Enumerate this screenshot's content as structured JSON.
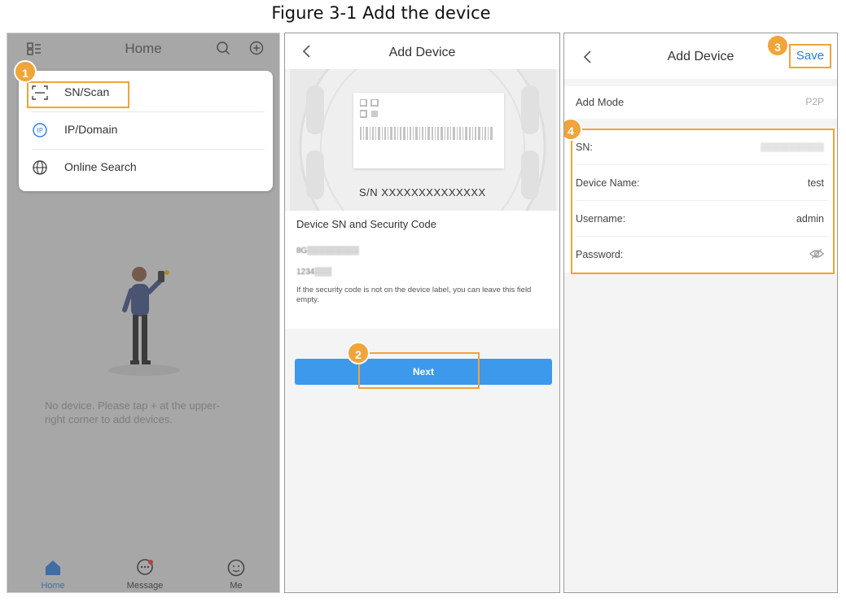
{
  "caption": "Figure 3-1 Add the device",
  "colors": {
    "accent": "#f0a43a",
    "blue": "#3d99ec",
    "link": "#2a7de1"
  },
  "panel1": {
    "title": "Home",
    "menu": [
      {
        "label": "SN/Scan",
        "icon": "scan-icon"
      },
      {
        "label": "IP/Domain",
        "icon": "ip-icon"
      },
      {
        "label": "Online Search",
        "icon": "globe-icon"
      }
    ],
    "empty_text": "No device. Please tap + at the upper-right corner to add devices.",
    "tabs": [
      {
        "label": "Home",
        "icon": "home-icon"
      },
      {
        "label": "Message",
        "icon": "message-icon"
      },
      {
        "label": "Me",
        "icon": "me-icon"
      }
    ]
  },
  "panel2": {
    "title": "Add Device",
    "sn_label": "S/N  XXXXXXXXXXXXXX",
    "section_title": "Device SN and Security Code",
    "sn_value": "8G▒▒▒▒▒▒▒▒▒",
    "code_value": "1234▒▒▒",
    "note": "If the security code is not on the device label, you can leave this field empty.",
    "next_label": "Next"
  },
  "panel3": {
    "title": "Add Device",
    "save_label": "Save",
    "add_mode_label": "Add Mode",
    "add_mode_value": "P2P",
    "fields": [
      {
        "label": "SN:",
        "value": "▒▒▒▒▒▒▒▒▒▒▒"
      },
      {
        "label": "Device Name:",
        "value": "test"
      },
      {
        "label": "Username:",
        "value": "admin"
      },
      {
        "label": "Password:",
        "value": ""
      }
    ]
  },
  "badges": [
    "1",
    "2",
    "3",
    "4"
  ]
}
